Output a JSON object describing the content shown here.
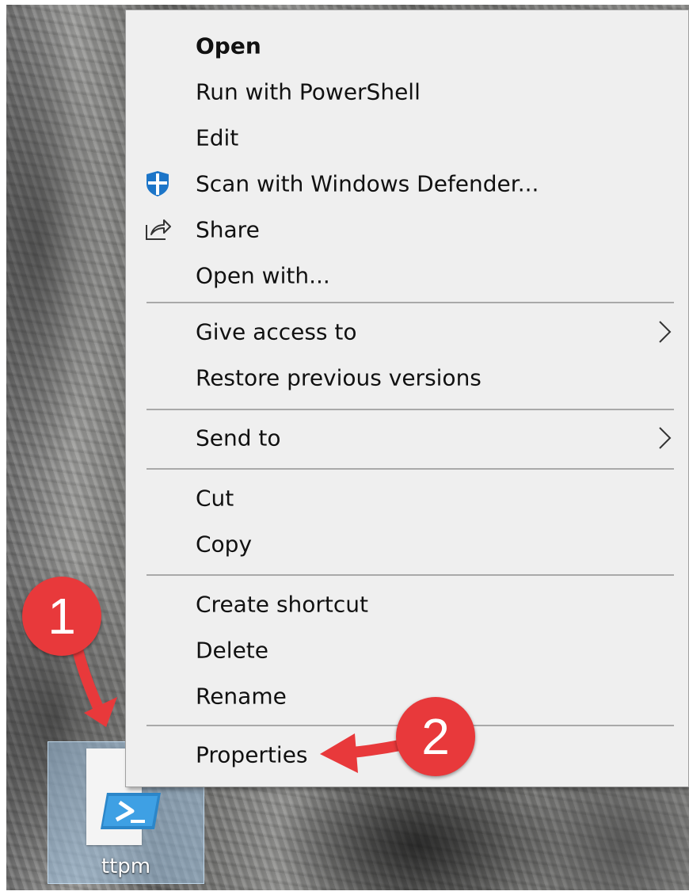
{
  "menu": {
    "items": [
      {
        "label": "Open"
      },
      {
        "label": "Run with PowerShell"
      },
      {
        "label": "Edit"
      },
      {
        "label": "Scan with Windows Defender..."
      },
      {
        "label": "Share"
      },
      {
        "label": "Open with..."
      },
      {
        "label": "Give access to"
      },
      {
        "label": "Restore previous versions"
      },
      {
        "label": "Send to"
      },
      {
        "label": "Cut"
      },
      {
        "label": "Copy"
      },
      {
        "label": "Create shortcut"
      },
      {
        "label": "Delete"
      },
      {
        "label": "Rename"
      },
      {
        "label": "Properties"
      }
    ]
  },
  "desktop": {
    "file_label": "ttpm",
    "file_icon": "powershell-script-icon"
  },
  "annotations": {
    "step1": "1",
    "step2": "2",
    "color": "#e8393b"
  },
  "icons": {
    "defender": "windows-defender-shield-icon",
    "share": "share-icon",
    "submenu": "chevron-right-icon"
  }
}
